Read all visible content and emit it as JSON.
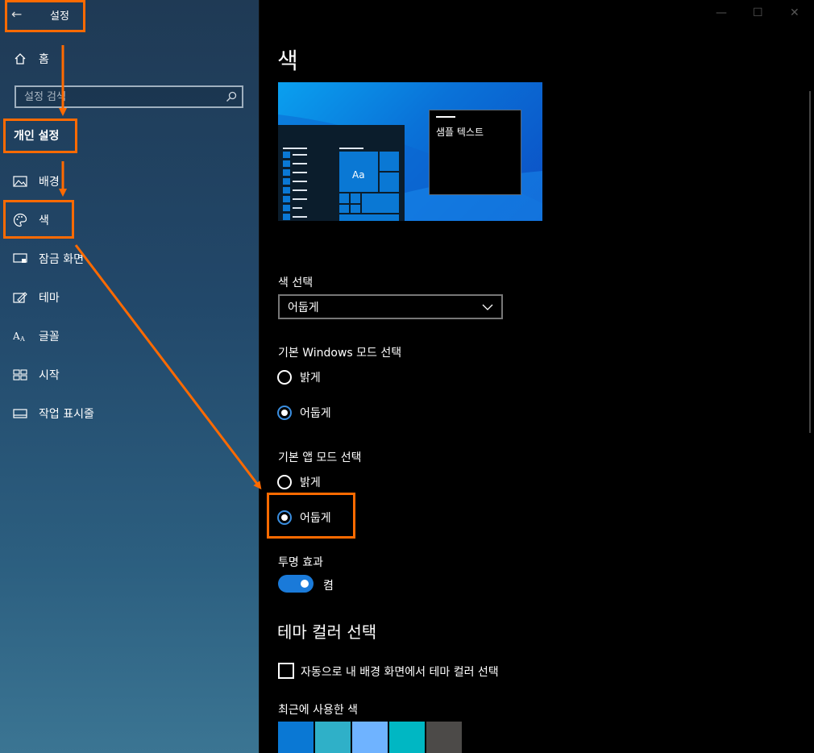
{
  "window": {
    "back_glyph": "←",
    "title": "설정",
    "min_glyph": "—",
    "max_glyph": "☐",
    "close_glyph": "✕"
  },
  "sidebar": {
    "home_label": "홈",
    "search_placeholder": "설정 검색",
    "section_header": "개인 설정",
    "items": [
      {
        "label": "배경",
        "icon": "image-icon"
      },
      {
        "label": "색",
        "icon": "palette-icon"
      },
      {
        "label": "잠금 화면",
        "icon": "lock-screen-icon"
      },
      {
        "label": "테마",
        "icon": "theme-edit-icon"
      },
      {
        "label": "글꼴",
        "icon": "font-icon"
      },
      {
        "label": "시작",
        "icon": "start-grid-icon"
      },
      {
        "label": "작업 표시줄",
        "icon": "taskbar-icon"
      }
    ]
  },
  "main": {
    "page_title": "색",
    "preview": {
      "sample_text": "샘플 텍스트",
      "tile_text": "Aa"
    },
    "color_select": {
      "label": "색 선택",
      "value": "어둡게"
    },
    "windows_mode": {
      "label": "기본 Windows 모드 선택",
      "options": [
        "밝게",
        "어둡게"
      ],
      "selected": "어둡게"
    },
    "app_mode": {
      "label": "기본 앱 모드 선택",
      "options": [
        "밝게",
        "어둡게"
      ],
      "selected": "어둡게"
    },
    "transparency": {
      "label": "투명 효과",
      "state": "켬",
      "on": true
    },
    "theme_color": {
      "title": "테마 컬러 선택",
      "auto_checkbox_label": "자동으로 내 배경 화면에서 테마 컬러 선택",
      "auto_checked": false,
      "recent_label": "최근에 사용한 색",
      "recent_colors": [
        "#0a78d4",
        "#2fb0c8",
        "#6fb3ff",
        "#00b7c3",
        "#4c4a48"
      ]
    }
  },
  "annotation": {
    "highlight_color": "#ff6a00"
  }
}
